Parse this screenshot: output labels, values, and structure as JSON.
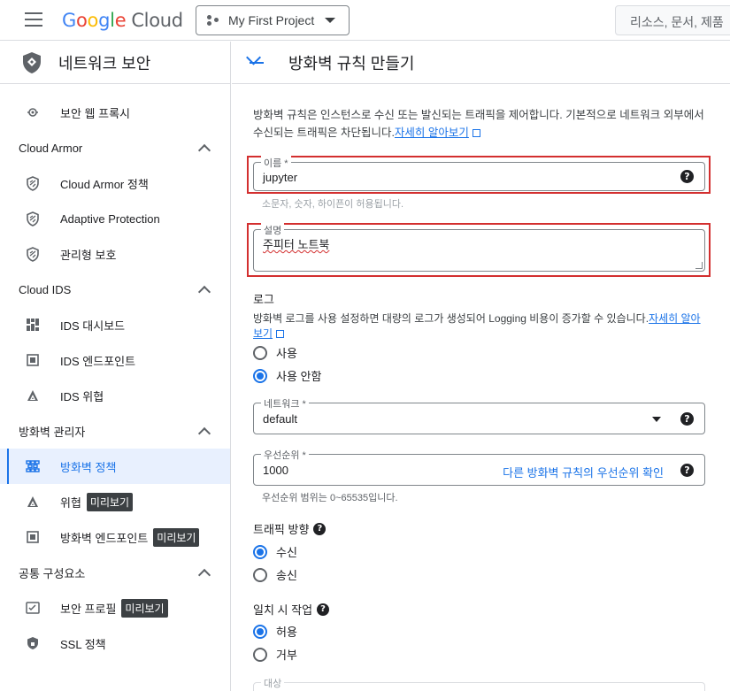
{
  "topbar": {
    "logo_letters": [
      "G",
      "o",
      "o",
      "g",
      "l",
      "e"
    ],
    "logo_cloud": "Cloud",
    "project": "My First Project",
    "search_placeholder": "리소스, 문서, 제품"
  },
  "sidebar": {
    "title": "네트워크 보안",
    "items_top": [
      {
        "label": "보안 웹 프록시",
        "icon": "web-proxy-icon"
      }
    ],
    "sections": [
      {
        "title": "Cloud Armor",
        "items": [
          {
            "label": "Cloud Armor 정책",
            "icon": "armor-shield-icon"
          },
          {
            "label": "Adaptive Protection",
            "icon": "armor-shield-icon"
          },
          {
            "label": "관리형 보호",
            "icon": "armor-shield-icon"
          }
        ]
      },
      {
        "title": "Cloud IDS",
        "items": [
          {
            "label": "IDS 대시보드",
            "icon": "dashboard-icon"
          },
          {
            "label": "IDS 엔드포인트",
            "icon": "endpoint-icon"
          },
          {
            "label": "IDS 위협",
            "icon": "threat-icon"
          }
        ]
      },
      {
        "title": "방화벽 관리자",
        "items": [
          {
            "label": "방화벽 정책",
            "icon": "firewall-policy-icon",
            "active": true
          },
          {
            "label": "위협",
            "icon": "threat-icon",
            "badge": "미리보기"
          },
          {
            "label": "방화벽 엔드포인트",
            "icon": "endpoint-icon",
            "badge": "미리보기"
          }
        ]
      },
      {
        "title": "공통 구성요소",
        "items": [
          {
            "label": "보안 프로필",
            "icon": "security-profile-icon",
            "badge": "미리보기"
          },
          {
            "label": "SSL 정책",
            "icon": "ssl-shield-icon"
          }
        ]
      }
    ]
  },
  "main": {
    "title": "방화벽 규칙 만들기",
    "description": "방화벽 규칙은 인스턴스로 수신 또는 발신되는 트래픽을 제어합니다. 기본적으로 네트워크 외부에서 수신되는 트래픽은 차단됩니다.",
    "description_link": "자세히 알아보기",
    "name": {
      "label": "이름 *",
      "value": "jupyter",
      "hint": "소문자, 숫자, 하이픈이 허용됩니다."
    },
    "desc_field": {
      "label": "설명",
      "value": "주피터 노트북"
    },
    "logs": {
      "title": "로그",
      "text": "방화벽 로그를 사용 설정하면 대량의 로그가 생성되어 Logging 비용이 증가할 수 있습니다.",
      "link": "자세히 알아보기",
      "options": [
        "사용",
        "사용 안함"
      ],
      "selected": 1
    },
    "network": {
      "label": "네트워크 *",
      "value": "default"
    },
    "priority": {
      "label": "우선순위 *",
      "value": "1000",
      "link": "다른 방화벽 규칙의 우선순위 확인",
      "hint": "우선순위 범위는 0~65535입니다."
    },
    "direction": {
      "title": "트래픽 방향",
      "options": [
        "수신",
        "송신"
      ],
      "selected": 0
    },
    "action": {
      "title": "일치 시 작업",
      "options": [
        "허용",
        "거부"
      ],
      "selected": 0
    },
    "target": {
      "label": "대상"
    }
  },
  "colors": {
    "accent": "#1a73e8",
    "highlight": "#d32f2f"
  }
}
